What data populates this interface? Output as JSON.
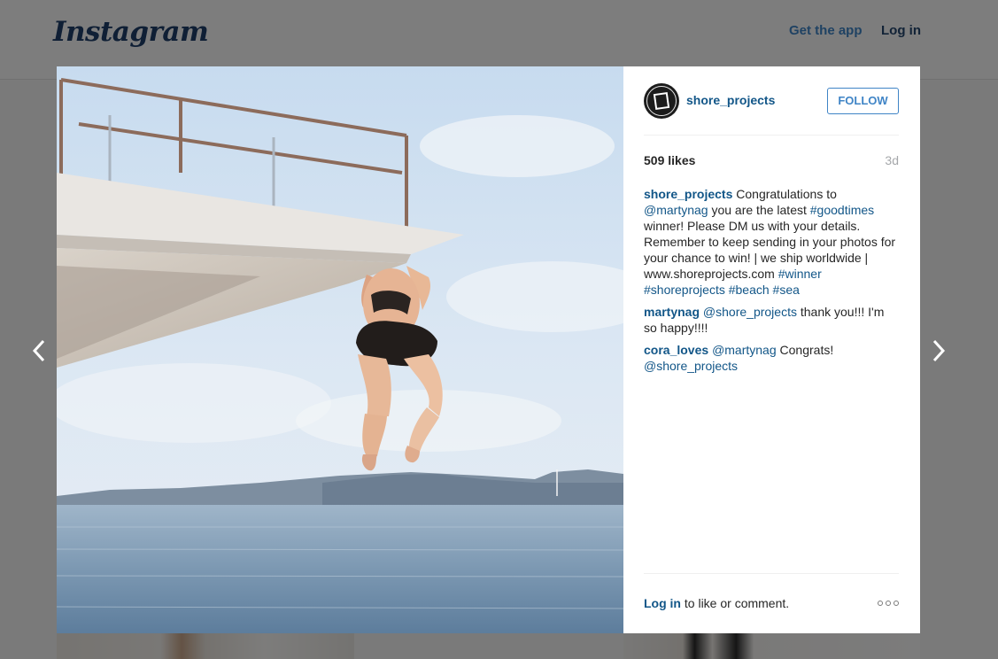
{
  "header": {
    "logo_text": "Instagram",
    "get_app_label": "Get the app",
    "login_label": "Log in"
  },
  "post": {
    "username": "shore_projects",
    "follow_label": "FOLLOW",
    "likes": "509 likes",
    "time_ago": "3d",
    "caption": {
      "user": "shore_projects",
      "segments": [
        {
          "text": " Congratulations to ",
          "tag": false
        },
        {
          "text": "@martynag",
          "tag": true
        },
        {
          "text": " you are the latest ",
          "tag": false
        },
        {
          "text": "#goodtimes",
          "tag": true
        },
        {
          "text": " winner! Please DM us with your details. Remember to keep sending in your photos for your chance to win! | we ship worldwide | www.shoreprojects.com ",
          "tag": false
        },
        {
          "text": "#winner",
          "tag": true
        },
        {
          "text": " ",
          "tag": false
        },
        {
          "text": "#shoreprojects",
          "tag": true
        },
        {
          "text": " ",
          "tag": false
        },
        {
          "text": "#beach",
          "tag": true
        },
        {
          "text": " ",
          "tag": false
        },
        {
          "text": "#sea",
          "tag": true
        }
      ]
    },
    "comments": [
      {
        "user": "martynag",
        "segments": [
          {
            "text": " ",
            "tag": false
          },
          {
            "text": "@shore_projects",
            "tag": true
          },
          {
            "text": " thank you!!! I'm so happy!!!!",
            "tag": false
          }
        ]
      },
      {
        "user": "cora_loves",
        "segments": [
          {
            "text": " ",
            "tag": false
          },
          {
            "text": "@martynag",
            "tag": true
          },
          {
            "text": " Congrats! ",
            "tag": false
          },
          {
            "text": "@shore_projects",
            "tag": true
          }
        ]
      }
    ],
    "footer": {
      "login_label": "Log in",
      "prompt_text": " to like or comment."
    }
  },
  "icons": {
    "prev": "chevron-left-icon",
    "next": "chevron-right-icon",
    "more": "more-options-icon",
    "avatar": "shore-projects-logo-icon"
  },
  "colors": {
    "link_blue": "#125688",
    "follow_blue": "#3f84c6",
    "muted_gray": "#a5a7aa"
  }
}
